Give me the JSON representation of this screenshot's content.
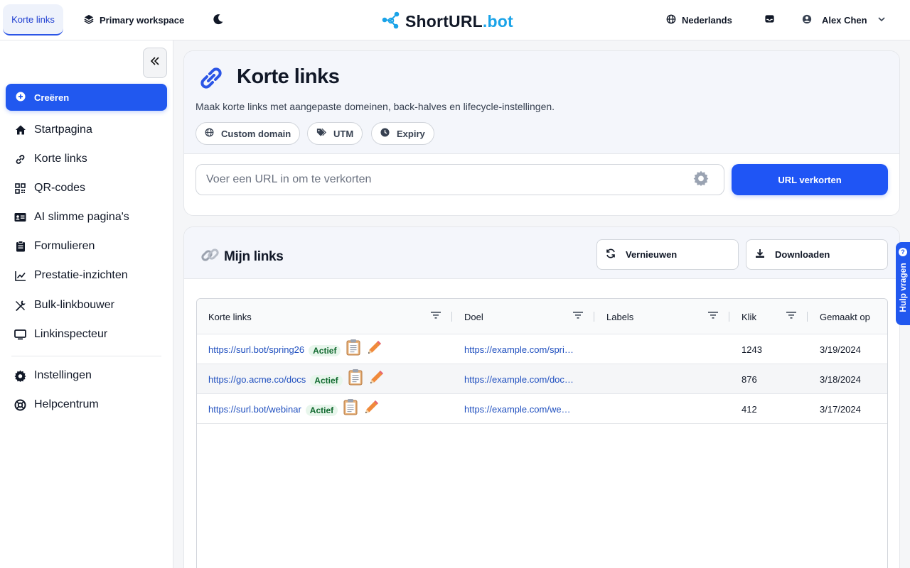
{
  "topbar": {
    "active_tab": "Korte links",
    "workspace": "Primary workspace",
    "language": "Nederlands",
    "user_name": "Alex Chen",
    "logo": {
      "part1": "ShortURL",
      "part2": ".bot"
    }
  },
  "sidebar": {
    "create_label": "Creëren",
    "items": [
      {
        "label": "Startpagina",
        "icon": "home-icon"
      },
      {
        "label": "Korte links",
        "icon": "link-icon"
      },
      {
        "label": "QR-codes",
        "icon": "qr-icon"
      },
      {
        "label": "AI slimme pagina's",
        "icon": "id-card-icon"
      },
      {
        "label": "Formulieren",
        "icon": "clipboard-icon"
      },
      {
        "label": "Prestatie-inzichten",
        "icon": "chart-line-icon"
      },
      {
        "label": "Bulk-linkbouwer",
        "icon": "tools-icon"
      },
      {
        "label": "Linkinspecteur",
        "icon": "monitor-icon"
      }
    ],
    "bottom_items": [
      {
        "label": "Instellingen",
        "icon": "gear-icon"
      },
      {
        "label": "Helpcentrum",
        "icon": "lifebuoy-icon"
      }
    ]
  },
  "header_card": {
    "title": "Korte links",
    "subtitle": "Maak korte links met aangepaste domeinen, back-halves en lifecycle-instellingen.",
    "chips": [
      "Custom domain",
      "UTM",
      "Expiry"
    ],
    "url_placeholder": "Voer een URL in om te verkorten",
    "shorten_label": "URL verkorten"
  },
  "links_card": {
    "title": "Mijn links",
    "refresh_label": "Vernieuwen",
    "download_label": "Downloaden",
    "columns": [
      "Korte links",
      "Doel",
      "Labels",
      "Klik",
      "Gemaakt op"
    ],
    "rows": [
      {
        "short": "https://surl.bot/spring26",
        "status": "Actief",
        "target": "https://example.com/spri…",
        "labels": "",
        "clicks": "1243",
        "created": "3/19/2024"
      },
      {
        "short": "https://go.acme.co/docs",
        "status": "Actief",
        "target": "https://example.com/doc…",
        "labels": "",
        "clicks": "876",
        "created": "3/18/2024"
      },
      {
        "short": "https://surl.bot/webinar",
        "status": "Actief",
        "target": "https://example.com/we…",
        "labels": "",
        "clicks": "412",
        "created": "3/17/2024"
      }
    ]
  },
  "help_tab": {
    "label": "Hulp vragen"
  },
  "colors": {
    "primary": "#2158ef",
    "logo_accent": "#1aa3e8",
    "badge_bg": "#e8f6ec",
    "badge_text": "#116a2f"
  }
}
